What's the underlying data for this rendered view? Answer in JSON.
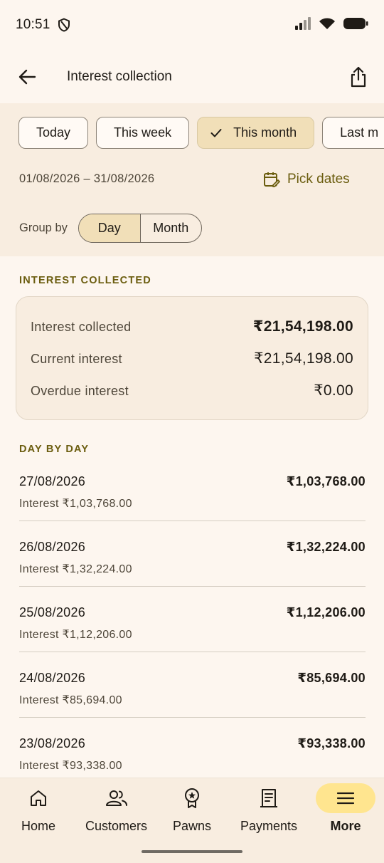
{
  "status_bar": {
    "time": "10:51",
    "icons": [
      "shield-icon",
      "signal-icon",
      "wifi-icon",
      "battery-icon"
    ]
  },
  "appbar": {
    "title": "Interest collection",
    "back_icon": "arrow-left-icon",
    "share_icon": "share-icon"
  },
  "filters": {
    "chips": [
      {
        "label": "Today",
        "selected": false
      },
      {
        "label": "This week",
        "selected": false
      },
      {
        "label": "This month",
        "selected": true
      },
      {
        "label": "Last m",
        "selected": false
      }
    ],
    "date_range": "01/08/2026 – 31/08/2026",
    "pick_dates_label": "Pick dates",
    "group_by_label": "Group by",
    "group_by_options": [
      {
        "label": "Day",
        "active": true
      },
      {
        "label": "Month",
        "active": false
      }
    ]
  },
  "summary": {
    "section_title": "INTEREST COLLECTED",
    "rows": [
      {
        "label": "Interest collected",
        "value": "₹21,54,198.00"
      },
      {
        "label": "Current interest",
        "value": "₹21,54,198.00"
      },
      {
        "label": "Overdue interest",
        "value": "₹0.00"
      }
    ]
  },
  "day_by_day": {
    "section_title": "DAY BY DAY",
    "items": [
      {
        "date": "27/08/2026",
        "sub": "Interest ₹1,03,768.00",
        "amount": "₹1,03,768.00"
      },
      {
        "date": "26/08/2026",
        "sub": "Interest ₹1,32,224.00",
        "amount": "₹1,32,224.00"
      },
      {
        "date": "25/08/2026",
        "sub": "Interest ₹1,12,206.00",
        "amount": "₹1,12,206.00"
      },
      {
        "date": "24/08/2026",
        "sub": "Interest ₹85,694.00",
        "amount": "₹85,694.00"
      },
      {
        "date": "23/08/2026",
        "sub": "Interest ₹93,338.00",
        "amount": "₹93,338.00"
      }
    ]
  },
  "bottom_nav": {
    "items": [
      {
        "label": "Home",
        "icon": "home-icon"
      },
      {
        "label": "Customers",
        "icon": "customers-icon"
      },
      {
        "label": "Pawns",
        "icon": "pawn-badge-icon"
      },
      {
        "label": "Payments",
        "icon": "receipt-icon"
      },
      {
        "label": "More",
        "icon": "menu-icon",
        "active": true
      }
    ]
  },
  "colors": {
    "background": "#fdf6ef",
    "panel": "#f8ede0",
    "accent": "#6b5d0f",
    "selected_chip": "#f1dfb8",
    "nav_active": "#ffe58f"
  }
}
